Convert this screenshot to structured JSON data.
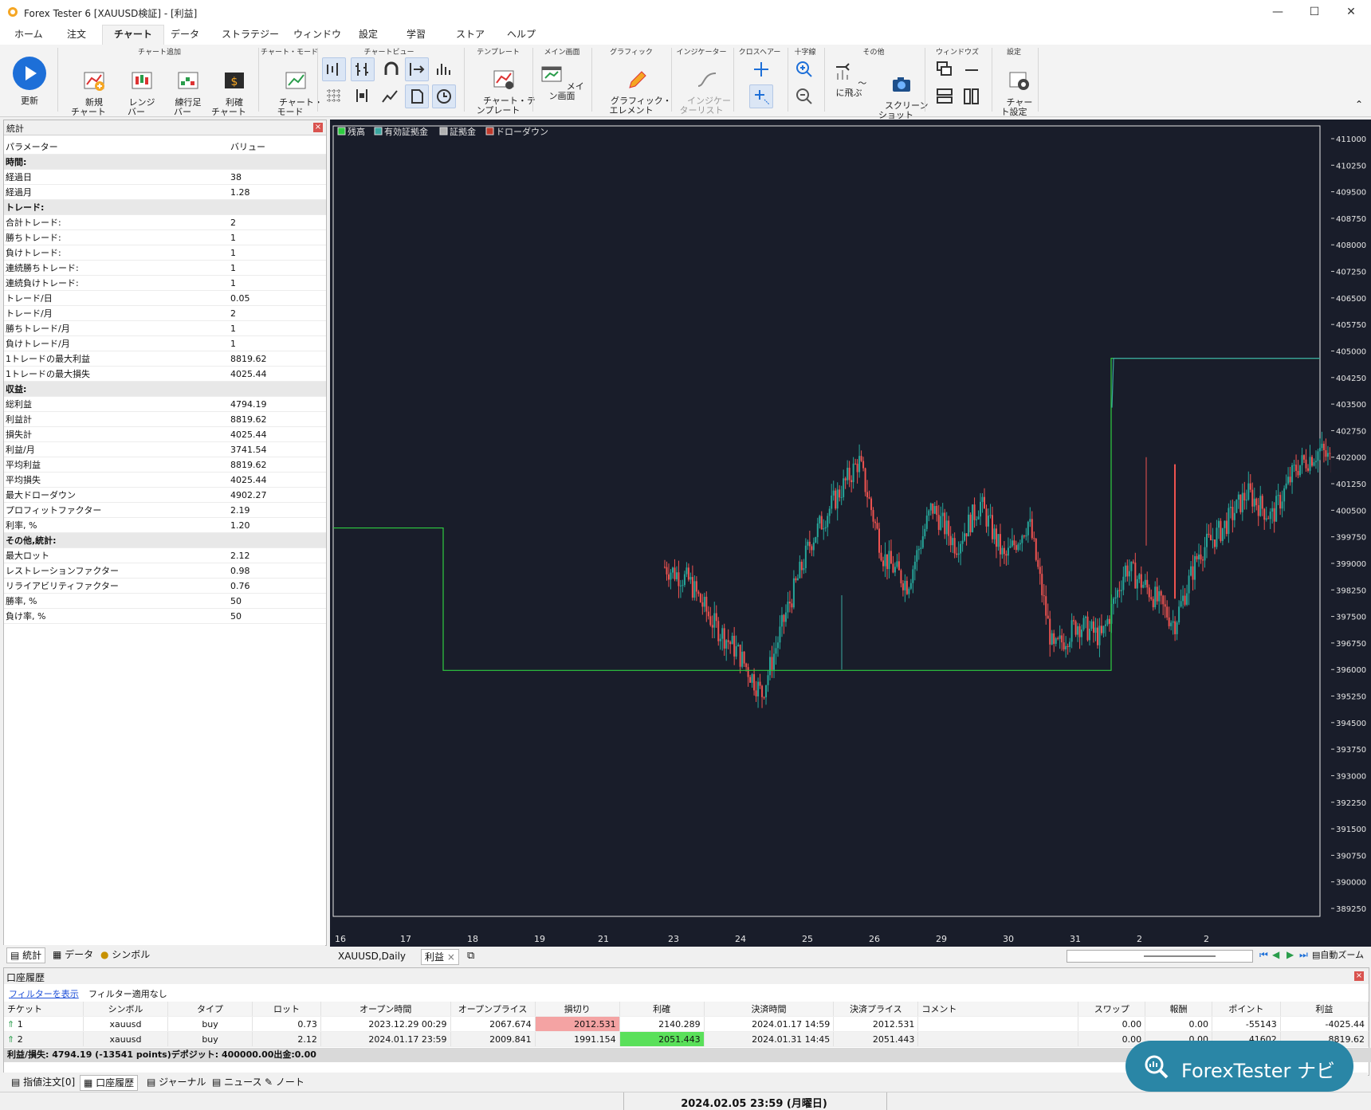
{
  "window": {
    "title": "Forex Tester 6  [XAUUSD検証] - [利益]",
    "minimize": "—",
    "maximize": "☐",
    "close": "✕"
  },
  "menu": [
    "ホーム",
    "注文",
    "チャート",
    "データ",
    "ストラテジー",
    "ウィンドウ",
    "設定",
    "学習",
    "ストア",
    "ヘルプ"
  ],
  "ribbon": {
    "groups": {
      "add_chart": "チャート追加",
      "chart_mode": "チャート・モード",
      "chart_view": "チャートビュー",
      "template": "テンプレート",
      "main_screen": "メイン画面",
      "graphic": "グラフィック",
      "indicator": "インジケーター",
      "crosshair": "クロスヘアー",
      "cross": "十字線",
      "other": "その他",
      "windows": "ウィンドウズ",
      "settings": "設定"
    },
    "update": "更新",
    "new_chart": "新規\nチャート",
    "range_bar": "レンジ\nバー",
    "renko_bar": "練行足\nバー",
    "profit_chart": "利確\nチャート",
    "chart_mode_btn": "チャート・\nモード",
    "chart_template": "チャート・テ\nンプレート",
    "main_screen_btn": "メイン画面",
    "graphic_element": "グラフィック・\nエレメント",
    "indicator_list": "インジケー\nターリスト",
    "jump_to": "〜に飛ぶ",
    "screenshot": "スクリーン\nショット",
    "chart_settings": "チャー\nト設定"
  },
  "stats": {
    "title": "統計",
    "header": [
      "パラメーター",
      "バリュー"
    ],
    "rows": [
      {
        "section": "時間:"
      },
      {
        "k": "経過日",
        "v": "38"
      },
      {
        "k": "経過月",
        "v": "1.28"
      },
      {
        "section": "トレード:"
      },
      {
        "k": "合計トレード:",
        "v": "2"
      },
      {
        "k": "勝ちトレード:",
        "v": "1"
      },
      {
        "k": "負けトレード:",
        "v": "1"
      },
      {
        "k": "連続勝ちトレード:",
        "v": "1"
      },
      {
        "k": "連続負けトレード:",
        "v": "1"
      },
      {
        "k": "トレード/日",
        "v": "0.05"
      },
      {
        "k": "トレード/月",
        "v": "2"
      },
      {
        "k": "勝ちトレード/月",
        "v": "1"
      },
      {
        "k": "負けトレード/月",
        "v": "1"
      },
      {
        "k": "1トレードの最大利益",
        "v": "8819.62"
      },
      {
        "k": "1トレードの最大損失",
        "v": "4025.44"
      },
      {
        "section": "収益:"
      },
      {
        "k": "総利益",
        "v": "4794.19"
      },
      {
        "k": "利益計",
        "v": "8819.62"
      },
      {
        "k": "損失計",
        "v": "4025.44"
      },
      {
        "k": "利益/月",
        "v": "3741.54"
      },
      {
        "k": "平均利益",
        "v": "8819.62"
      },
      {
        "k": "平均損失",
        "v": "4025.44"
      },
      {
        "k": "最大ドローダウン",
        "v": "4902.27"
      },
      {
        "k": "プロフィットファクター",
        "v": "2.19"
      },
      {
        "k": "利率, %",
        "v": "1.20"
      },
      {
        "section": "その他,統計:"
      },
      {
        "k": "最大ロット",
        "v": "2.12"
      },
      {
        "k": "レストレーションファクター",
        "v": "0.98"
      },
      {
        "k": "リライアビリティファクター",
        "v": "0.76"
      },
      {
        "k": "勝率, %",
        "v": "50"
      },
      {
        "k": "負け率, %",
        "v": "50"
      }
    ]
  },
  "left_tabs": [
    "統計",
    "データ",
    "シンボル"
  ],
  "chart_tabs": {
    "symbol": "XAUUSD,Daily",
    "profit": "利益",
    "close": "×",
    "autozoom": "自動ズーム"
  },
  "colors": {
    "balance": "#2ecc40",
    "equity": "#3aa6a0",
    "margin": "#b0b0b0",
    "drawdown": "#c0392b",
    "bull": "#26a69a",
    "bear": "#ef5350",
    "bg": "#191d2a"
  },
  "chart_data": {
    "type": "line",
    "legend": [
      "残高",
      "有効証拠金",
      "証拠金",
      "ドローダウン"
    ],
    "legend_position": "top-left",
    "x_ticks": [
      "16",
      "17",
      "18",
      "19",
      "21",
      "23",
      "24",
      "25",
      "26",
      "29",
      "30",
      "31",
      "2",
      "2"
    ],
    "y_ticks": [
      "411000",
      "410250",
      "409500",
      "408750",
      "408000",
      "407250",
      "406500",
      "405750",
      "405000",
      "404250",
      "403500",
      "402750",
      "402000",
      "401250",
      "400500",
      "399750",
      "399000",
      "398250",
      "397500",
      "396750",
      "396000",
      "395250",
      "394500",
      "393750",
      "393000",
      "392250",
      "391500",
      "390750",
      "390000",
      "389250"
    ],
    "ylim": [
      389250,
      411000
    ],
    "balance": [
      400000,
      400000,
      395975,
      395975,
      395975,
      404794,
      404794
    ],
    "equity_approx": [
      398900,
      398500,
      397300,
      396500,
      395300,
      397600,
      399600,
      400800,
      401900,
      399200,
      398400,
      400600,
      399500,
      400700,
      399100,
      400200,
      396500,
      397300,
      396900,
      398900,
      398200,
      397300,
      399300,
      400000,
      401000,
      400300,
      401700,
      402200,
      401500,
      402500,
      403500,
      404794
    ]
  },
  "history": {
    "title": "口座履歴",
    "filter_link": "フィルターを表示",
    "filter_status": "フィルター適用なし",
    "columns": [
      "チケット",
      "シンボル",
      "タイプ",
      "ロット",
      "オープン時間",
      "オープンプライス",
      "損切り",
      "利確",
      "決済時間",
      "決済プライス",
      "コメント",
      "スワップ",
      "報酬",
      "ポイント",
      "利益"
    ],
    "rows": [
      [
        "1",
        "xauusd",
        "buy",
        "0.73",
        "2023.12.29 00:29",
        "2067.674",
        "2012.531",
        "2140.289",
        "2024.01.17 14:59",
        "2012.531",
        "",
        "0.00",
        "0.00",
        "-55143",
        "-4025.44"
      ],
      [
        "2",
        "xauusd",
        "buy",
        "2.12",
        "2024.01.17 23:59",
        "2009.841",
        "1991.154",
        "2051.443",
        "2024.01.31 14:45",
        "2051.443",
        "",
        "0.00",
        "0.00",
        "41602",
        "8819.62"
      ]
    ],
    "summary": "利益/損失: 4794.19 (-13541 points)デポジット: 400000.00出金:0.00"
  },
  "bottom_tabs": [
    "指値注文[0]",
    "口座履歴",
    "ジャーナル",
    "ニュース",
    "ノート"
  ],
  "status": "2024.02.05 23:59 (月曜日)",
  "badge": "ForexTester ナビ"
}
